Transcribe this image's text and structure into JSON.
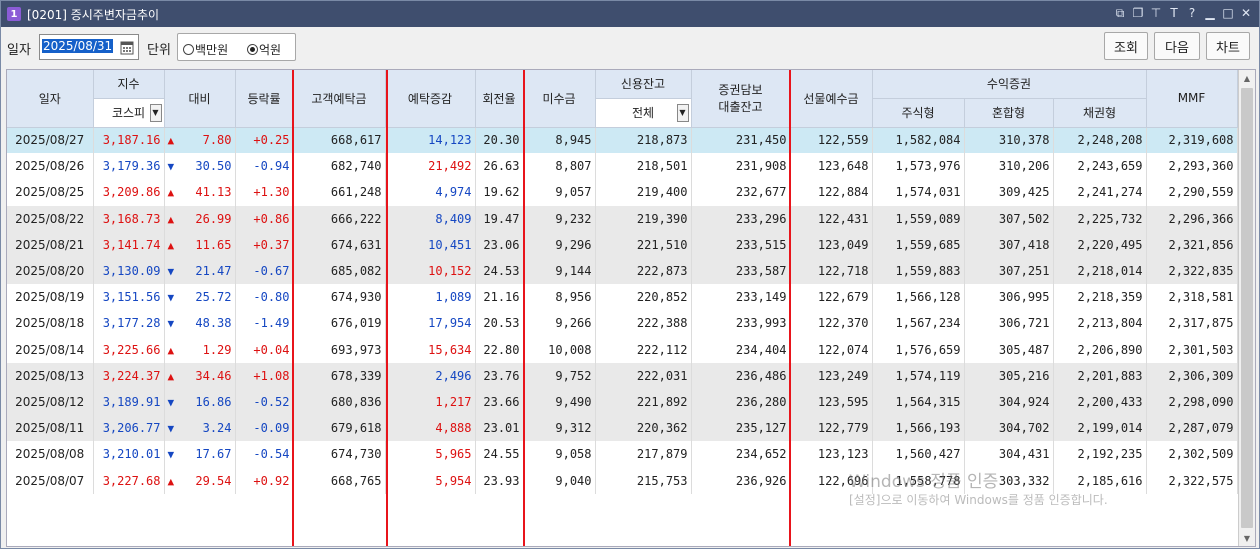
{
  "window": {
    "number": "1",
    "title": "[0201] 증시주변자금추이"
  },
  "toolbar": {
    "date_label": "일자",
    "date_value": "2025/08/31",
    "unit_label": "단위",
    "units": [
      {
        "label": "백만원",
        "selected": false
      },
      {
        "label": "억원",
        "selected": true
      }
    ],
    "buttons": {
      "query": "조회",
      "next": "다음",
      "chart": "차트"
    }
  },
  "headers": {
    "date": "일자",
    "index": "지수",
    "index_select": "코스피",
    "change": "대비",
    "rate": "등락률",
    "deposit": "고객예탁금",
    "deposit_change": "예탁증감",
    "turnover": "회전율",
    "unpaid": "미수금",
    "credit": "신용잔고",
    "credit_select": "전체",
    "collateral_line1": "증권담보",
    "collateral_line2": "대출잔고",
    "futures": "선물예수금",
    "bs": "수익증권",
    "stock": "주식형",
    "mixed": "혼합형",
    "bond": "채권형",
    "mmf": "MMF"
  },
  "rows": [
    {
      "date": "2025/08/27",
      "index": "3,187.16",
      "dir": "up",
      "change": "7.80",
      "rate": "+0.25",
      "deposit": "668,617",
      "dep_chg": "14,123",
      "dep_dir": "up",
      "turnover": "20.30",
      "unpaid": "8,945",
      "credit": "218,873",
      "collateral": "231,450",
      "futures": "122,559",
      "stock": "1,582,084",
      "mixed": "310,378",
      "bond": "2,248,208",
      "mmf": "2,319,608"
    },
    {
      "date": "2025/08/26",
      "index": "3,179.36",
      "dir": "down",
      "change": "30.50",
      "rate": "-0.94",
      "deposit": "682,740",
      "dep_chg": "21,492",
      "dep_dir": "down",
      "turnover": "26.63",
      "unpaid": "8,807",
      "credit": "218,501",
      "collateral": "231,908",
      "futures": "123,648",
      "stock": "1,573,976",
      "mixed": "310,206",
      "bond": "2,243,659",
      "mmf": "2,293,360"
    },
    {
      "date": "2025/08/25",
      "index": "3,209.86",
      "dir": "up",
      "change": "41.13",
      "rate": "+1.30",
      "deposit": "661,248",
      "dep_chg": "4,974",
      "dep_dir": "up",
      "turnover": "19.62",
      "unpaid": "9,057",
      "credit": "219,400",
      "collateral": "232,677",
      "futures": "122,884",
      "stock": "1,574,031",
      "mixed": "309,425",
      "bond": "2,241,274",
      "mmf": "2,290,559"
    },
    {
      "date": "2025/08/22",
      "index": "3,168.73",
      "dir": "up",
      "change": "26.99",
      "rate": "+0.86",
      "deposit": "666,222",
      "dep_chg": "8,409",
      "dep_dir": "up",
      "turnover": "19.47",
      "unpaid": "9,232",
      "credit": "219,390",
      "collateral": "233,296",
      "futures": "122,431",
      "stock": "1,559,089",
      "mixed": "307,502",
      "bond": "2,225,732",
      "mmf": "2,296,366"
    },
    {
      "date": "2025/08/21",
      "index": "3,141.74",
      "dir": "up",
      "change": "11.65",
      "rate": "+0.37",
      "deposit": "674,631",
      "dep_chg": "10,451",
      "dep_dir": "up",
      "turnover": "23.06",
      "unpaid": "9,296",
      "credit": "221,510",
      "collateral": "233,515",
      "futures": "123,049",
      "stock": "1,559,685",
      "mixed": "307,418",
      "bond": "2,220,495",
      "mmf": "2,321,856"
    },
    {
      "date": "2025/08/20",
      "index": "3,130.09",
      "dir": "down",
      "change": "21.47",
      "rate": "-0.67",
      "deposit": "685,082",
      "dep_chg": "10,152",
      "dep_dir": "down",
      "turnover": "24.53",
      "unpaid": "9,144",
      "credit": "222,873",
      "collateral": "233,587",
      "futures": "122,718",
      "stock": "1,559,883",
      "mixed": "307,251",
      "bond": "2,218,014",
      "mmf": "2,322,835"
    },
    {
      "date": "2025/08/19",
      "index": "3,151.56",
      "dir": "down",
      "change": "25.72",
      "rate": "-0.80",
      "deposit": "674,930",
      "dep_chg": "1,089",
      "dep_dir": "up",
      "turnover": "21.16",
      "unpaid": "8,956",
      "credit": "220,852",
      "collateral": "233,149",
      "futures": "122,679",
      "stock": "1,566,128",
      "mixed": "306,995",
      "bond": "2,218,359",
      "mmf": "2,318,581"
    },
    {
      "date": "2025/08/18",
      "index": "3,177.28",
      "dir": "down",
      "change": "48.38",
      "rate": "-1.49",
      "deposit": "676,019",
      "dep_chg": "17,954",
      "dep_dir": "up",
      "turnover": "20.53",
      "unpaid": "9,266",
      "credit": "222,388",
      "collateral": "233,993",
      "futures": "122,370",
      "stock": "1,567,234",
      "mixed": "306,721",
      "bond": "2,213,804",
      "mmf": "2,317,875"
    },
    {
      "date": "2025/08/14",
      "index": "3,225.66",
      "dir": "up",
      "change": "1.29",
      "rate": "+0.04",
      "deposit": "693,973",
      "dep_chg": "15,634",
      "dep_dir": "down",
      "turnover": "22.80",
      "unpaid": "10,008",
      "credit": "222,112",
      "collateral": "234,404",
      "futures": "122,074",
      "stock": "1,576,659",
      "mixed": "305,487",
      "bond": "2,206,890",
      "mmf": "2,301,503"
    },
    {
      "date": "2025/08/13",
      "index": "3,224.37",
      "dir": "up",
      "change": "34.46",
      "rate": "+1.08",
      "deposit": "678,339",
      "dep_chg": "2,496",
      "dep_dir": "up",
      "turnover": "23.76",
      "unpaid": "9,752",
      "credit": "222,031",
      "collateral": "236,486",
      "futures": "123,249",
      "stock": "1,574,119",
      "mixed": "305,216",
      "bond": "2,201,883",
      "mmf": "2,306,309"
    },
    {
      "date": "2025/08/12",
      "index": "3,189.91",
      "dir": "down",
      "change": "16.86",
      "rate": "-0.52",
      "deposit": "680,836",
      "dep_chg": "1,217",
      "dep_dir": "down",
      "turnover": "23.66",
      "unpaid": "9,490",
      "credit": "221,892",
      "collateral": "236,280",
      "futures": "123,595",
      "stock": "1,564,315",
      "mixed": "304,924",
      "bond": "2,200,433",
      "mmf": "2,298,090"
    },
    {
      "date": "2025/08/11",
      "index": "3,206.77",
      "dir": "down",
      "change": "3.24",
      "rate": "-0.09",
      "deposit": "679,618",
      "dep_chg": "4,888",
      "dep_dir": "down",
      "turnover": "23.01",
      "unpaid": "9,312",
      "credit": "220,362",
      "collateral": "235,127",
      "futures": "122,779",
      "stock": "1,566,193",
      "mixed": "304,702",
      "bond": "2,199,014",
      "mmf": "2,287,079"
    },
    {
      "date": "2025/08/08",
      "index": "3,210.01",
      "dir": "down",
      "change": "17.67",
      "rate": "-0.54",
      "deposit": "674,730",
      "dep_chg": "5,965",
      "dep_dir": "down",
      "turnover": "24.55",
      "unpaid": "9,058",
      "credit": "217,879",
      "collateral": "234,652",
      "futures": "123,123",
      "stock": "1,560,427",
      "mixed": "304,431",
      "bond": "2,192,235",
      "mmf": "2,302,509"
    },
    {
      "date": "2025/08/07",
      "index": "3,227.68",
      "dir": "up",
      "change": "29.54",
      "rate": "+0.92",
      "deposit": "668,765",
      "dep_chg": "5,954",
      "dep_dir": "down",
      "turnover": "23.93",
      "unpaid": "9,040",
      "credit": "215,753",
      "collateral": "236,926",
      "futures": "122,696",
      "stock": "1,558,778",
      "mixed": "303,332",
      "bond": "2,185,616",
      "mmf": "2,322,575"
    }
  ],
  "watermark": {
    "line1": "Windows 정품 인증",
    "line2": "[설정]으로 이동하여 Windows를 정품 인증합니다."
  },
  "colors": {
    "up": "#dd1111",
    "down": "#1547c2",
    "selected_row": "#cde9f4",
    "header": "#dde7f4",
    "highlight": "#e8141b"
  }
}
